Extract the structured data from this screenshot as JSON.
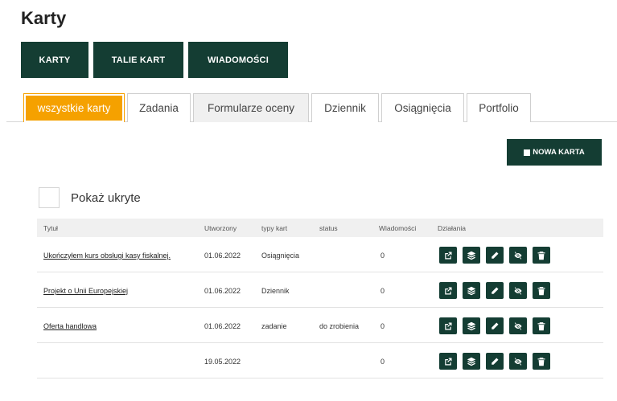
{
  "page": {
    "title": "Karty"
  },
  "top_nav": [
    {
      "label": "KARTY"
    },
    {
      "label": "TALIE KART"
    },
    {
      "label": "WIADOMOŚCI"
    }
  ],
  "tabs": [
    {
      "label": "wszystkie karty",
      "active": true
    },
    {
      "label": "Zadania"
    },
    {
      "label": "Formularze oceny"
    },
    {
      "label": "Dziennik"
    },
    {
      "label": "Osiągnięcia"
    },
    {
      "label": "Portfolio"
    }
  ],
  "new_card": {
    "label": "NOWA KARTA"
  },
  "show_hidden": {
    "label": "Pokaż ukryte",
    "checked": false
  },
  "table": {
    "headers": [
      "Tytuł",
      "Utworzony",
      "typy kart",
      "status",
      "Wiadomości",
      "Działania"
    ],
    "rows": [
      {
        "title": "Ukończyłem kurs obsługi kasy fiskalnej.",
        "created": "01.06.2022",
        "type": "Osiągnięcia",
        "status": "",
        "messages": "0"
      },
      {
        "title": "Projekt o Unii Europejskiej",
        "created": "01.06.2022",
        "type": "Dziennik",
        "status": "",
        "messages": "0"
      },
      {
        "title": "Oferta handlowa",
        "created": "01.06.2022",
        "type": "zadanie",
        "status": "do zrobienia",
        "messages": "0"
      },
      {
        "title": "",
        "created": "19.05.2022",
        "type": "",
        "status": "",
        "messages": "0"
      }
    ],
    "action_icons": [
      "external-link-icon",
      "layers-icon",
      "pencil-icon",
      "eye-slash-icon",
      "trash-icon"
    ]
  },
  "colors": {
    "primary": "#143d33",
    "active_tab": "#f5a100"
  }
}
